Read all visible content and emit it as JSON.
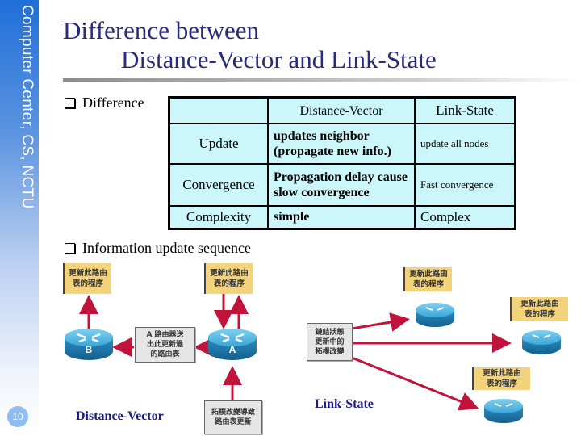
{
  "sidebar": {
    "text": "Computer Center, CS, NCTU",
    "page_number": "10"
  },
  "title": {
    "line1": "Difference between",
    "line2": "Distance-Vector and Link-State"
  },
  "bullets": {
    "difference": "Difference",
    "sequence": "Information update sequence"
  },
  "table": {
    "headers": [
      "",
      "Distance-Vector",
      "Link-State"
    ],
    "rows": [
      {
        "label": "Update",
        "dv": "updates neighbor (propagate new info.)",
        "ls": "update all nodes"
      },
      {
        "label": "Convergence",
        "dv": "Propagation delay cause slow convergence",
        "ls": "Fast convergence"
      },
      {
        "label": "Complexity",
        "dv": "simple",
        "ls": "Complex"
      }
    ]
  },
  "diagram": {
    "note_text": "更新此路由\n表的程序",
    "dv_send_box": "A 路由器送\n出此更新過\n的路由表",
    "dv_trigger_box": "拓樸改變導致\n路由表更新",
    "ls_trigger_box": "鏈結狀態\n更新中的\n拓樸改變",
    "router_b": "B",
    "router_a": "A",
    "dv_caption": "Distance-Vector",
    "ls_caption": "Link-State",
    "arrow_color": "#c0143c",
    "note_color": "#f3d37c",
    "router_color": "#2b9bd0"
  }
}
